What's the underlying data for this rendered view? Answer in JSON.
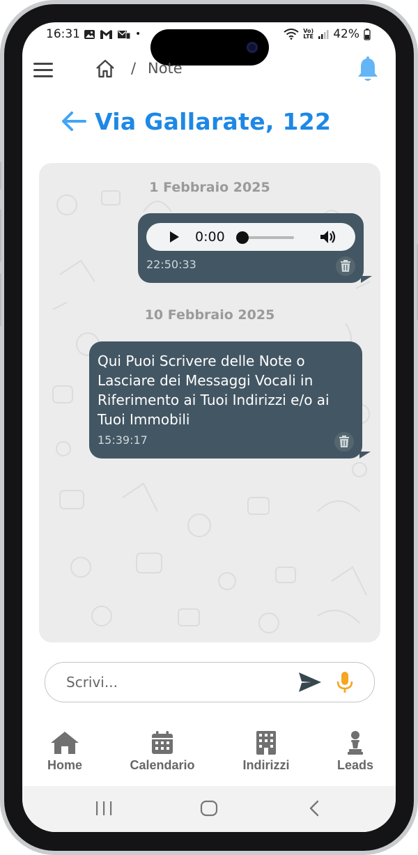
{
  "status_bar": {
    "time": "16:31",
    "dot": "•",
    "battery": "42%",
    "net_top": "Vo)",
    "net_bottom": "LTE"
  },
  "breadcrumb": {
    "separator": "/",
    "page": "Note"
  },
  "page": {
    "title": "Via Gallarate, 122"
  },
  "chat": {
    "groups": [
      {
        "date": "1 Febbraio 2025",
        "message": {
          "type": "audio",
          "audio_time": "0:00",
          "progress": 0,
          "timestamp": "22:50:33"
        }
      },
      {
        "date": "10 Febbraio 2025",
        "message": {
          "type": "text",
          "text": "Qui Puoi Scrivere delle Note o Lasciare dei Messaggi Vocali in Riferimento ai Tuoi Indirizzi e/o ai Tuoi Immobili",
          "timestamp": "15:39:17"
        }
      }
    ]
  },
  "composer": {
    "placeholder": "Scrivi..."
  },
  "bottom_nav": {
    "items": [
      {
        "label": "Home",
        "icon": "home-icon"
      },
      {
        "label": "Calendario",
        "icon": "calendar-icon"
      },
      {
        "label": "Indirizzi",
        "icon": "building-icon"
      },
      {
        "label": "Leads",
        "icon": "pawn-icon"
      }
    ]
  },
  "colors": {
    "accent": "#1e88e5",
    "bubble": "#435663",
    "mic": "#f5a623",
    "chat_bg": "#ececec"
  }
}
